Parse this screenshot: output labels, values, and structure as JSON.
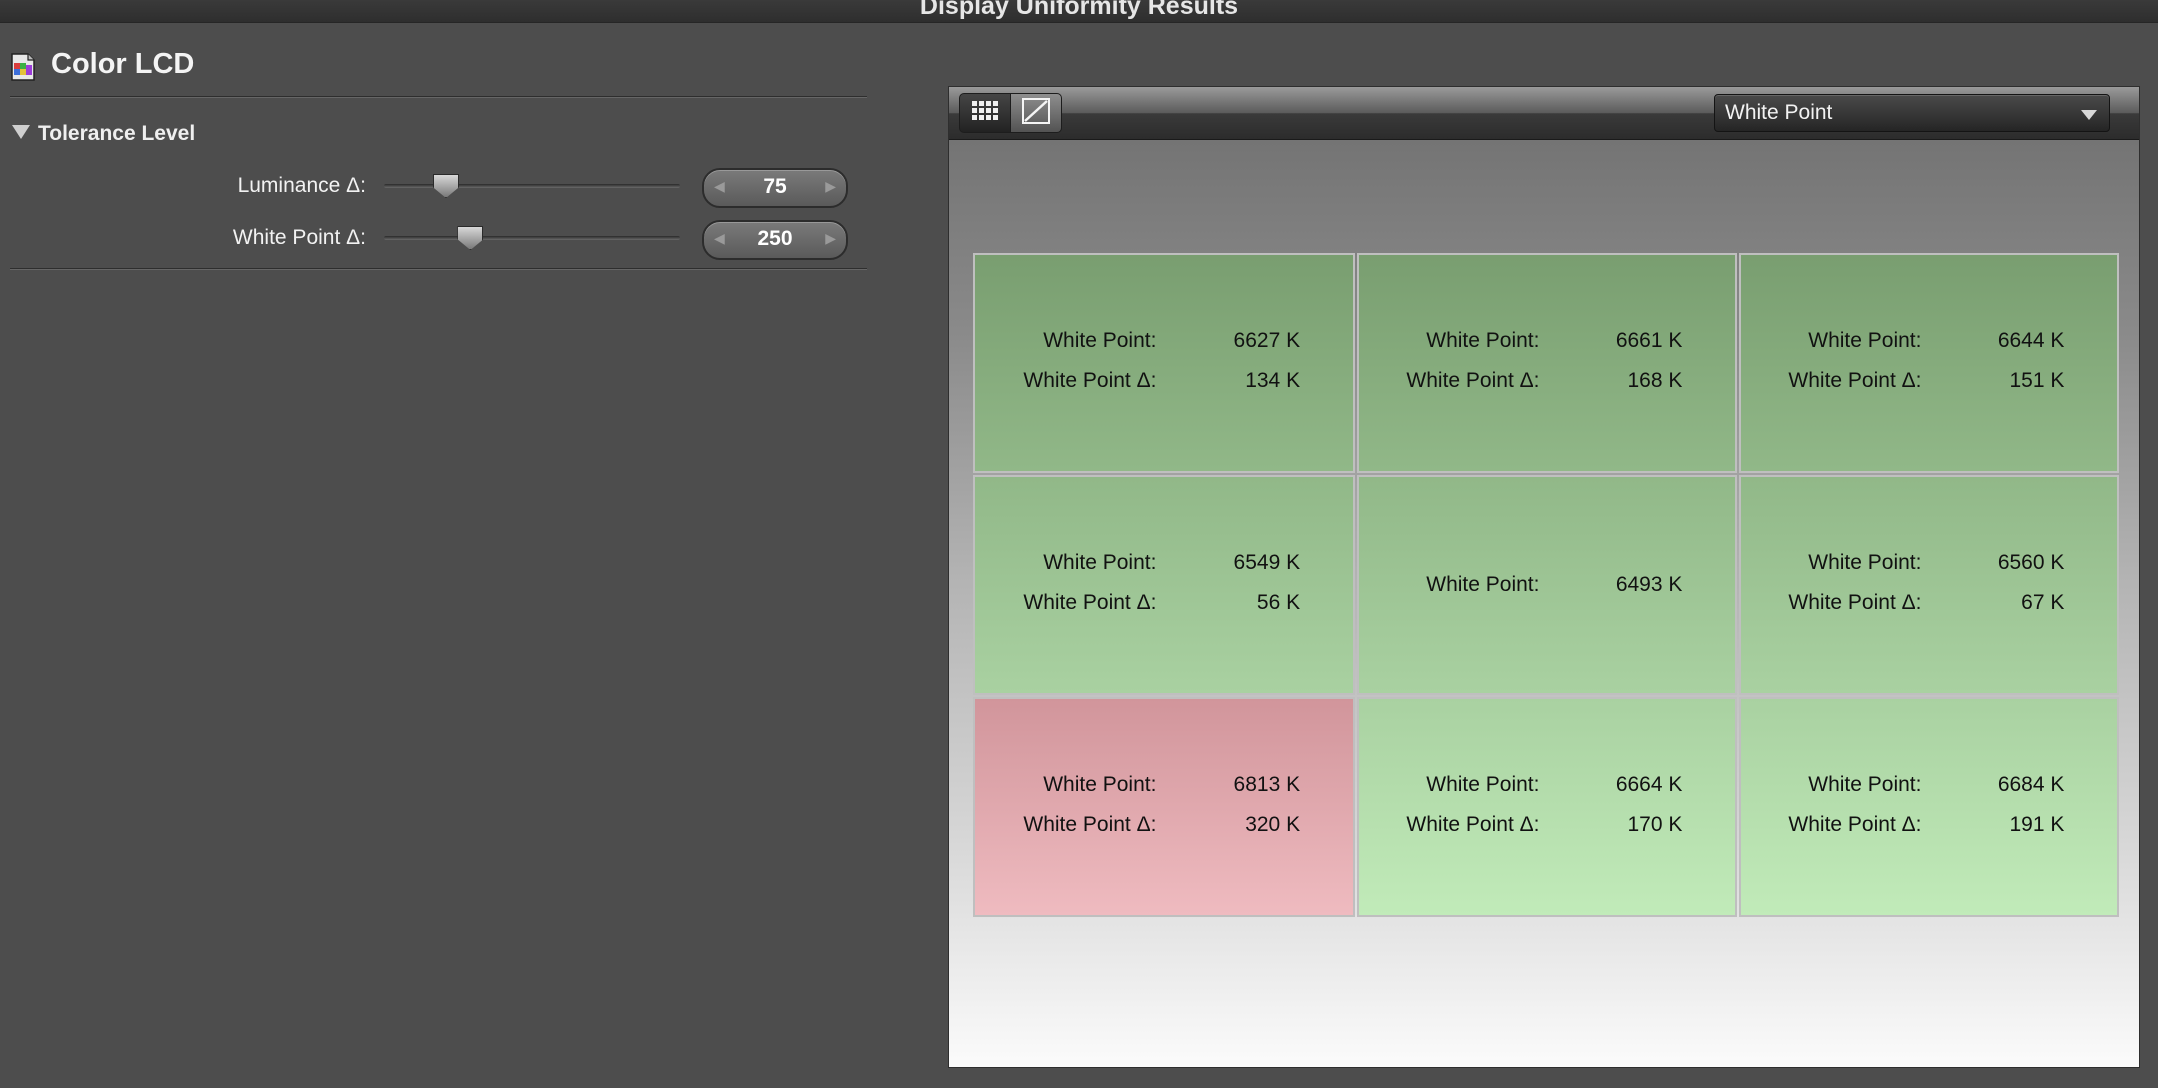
{
  "window": {
    "title": "Display Uniformity Results"
  },
  "device": {
    "name": "Color LCD",
    "icon": "display-profile-icon"
  },
  "tolerance": {
    "section_title": "Tolerance Level",
    "luminance": {
      "label": "Luminance  Δ:",
      "value": "75",
      "level": 0.18
    },
    "white_point": {
      "label": "White Point Δ:",
      "value": "250",
      "level": 0.27
    }
  },
  "toolbar": {
    "grid_view_icon": "grid-icon",
    "graph_view_icon": "graph-icon",
    "mode_dropdown": "White Point"
  },
  "colors": {
    "pass_top": "#799e70",
    "pass_bottom": "#c1ebb9",
    "fail_top": "#d1959b",
    "fail_bottom": "#efbbc0"
  },
  "cells": [
    {
      "status": "pass",
      "wp_label": "White Point:",
      "wp_value": "6627 K",
      "delta_label": "White Point Δ:",
      "delta_value": "134 K"
    },
    {
      "status": "pass",
      "wp_label": "White Point:",
      "wp_value": "6661 K",
      "delta_label": "White Point Δ:",
      "delta_value": "168 K"
    },
    {
      "status": "pass",
      "wp_label": "White Point:",
      "wp_value": "6644 K",
      "delta_label": "White Point Δ:",
      "delta_value": "151 K"
    },
    {
      "status": "pass",
      "wp_label": "White Point:",
      "wp_value": "6549 K",
      "delta_label": "White Point Δ:",
      "delta_value": "56 K"
    },
    {
      "status": "reference",
      "wp_label": "White Point:",
      "wp_value": "6493 K"
    },
    {
      "status": "pass",
      "wp_label": "White Point:",
      "wp_value": "6560 K",
      "delta_label": "White Point Δ:",
      "delta_value": "67 K"
    },
    {
      "status": "fail",
      "wp_label": "White Point:",
      "wp_value": "6813 K",
      "delta_label": "White Point Δ:",
      "delta_value": "320 K"
    },
    {
      "status": "pass",
      "wp_label": "White Point:",
      "wp_value": "6664 K",
      "delta_label": "White Point Δ:",
      "delta_value": "170 K"
    },
    {
      "status": "pass",
      "wp_label": "White Point:",
      "wp_value": "6684 K",
      "delta_label": "White Point Δ:",
      "delta_value": "191 K"
    }
  ]
}
